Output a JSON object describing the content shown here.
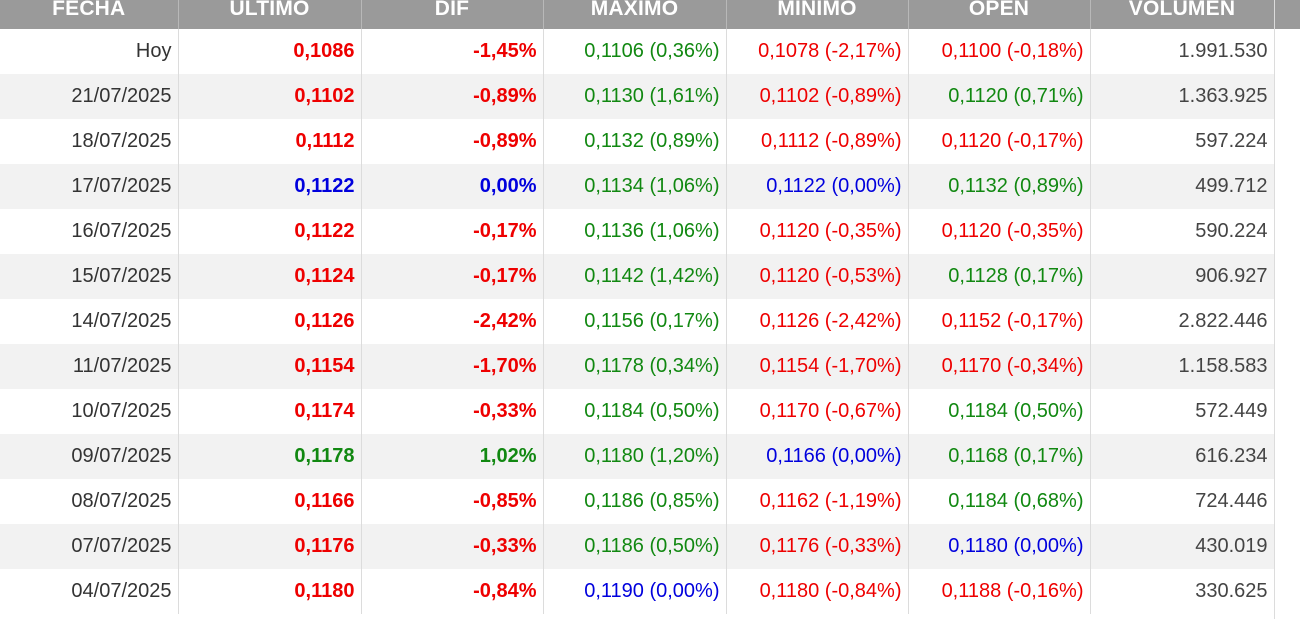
{
  "colors": {
    "red": "#ee0000",
    "green": "#118811",
    "blue": "#0000dd",
    "header_bg": "#9a9a9a"
  },
  "headers": [
    "FECHA",
    "ULTIMO",
    "DIF",
    "MAXIMO",
    "MINIMO",
    "OPEN",
    "VOLUMEN"
  ],
  "rows": [
    {
      "fecha": "Hoy",
      "ultimo": "0,1086",
      "ultimo_c": "red",
      "dif": "-1,45%",
      "dif_c": "red",
      "max": "0,1106 (0,36%)",
      "max_c": "green",
      "min": "0,1078 (-2,17%)",
      "min_c": "red",
      "open": "0,1100 (-0,18%)",
      "open_c": "red",
      "vol": "1.991.530"
    },
    {
      "fecha": "21/07/2025",
      "ultimo": "0,1102",
      "ultimo_c": "red",
      "dif": "-0,89%",
      "dif_c": "red",
      "max": "0,1130 (1,61%)",
      "max_c": "green",
      "min": "0,1102 (-0,89%)",
      "min_c": "red",
      "open": "0,1120 (0,71%)",
      "open_c": "green",
      "vol": "1.363.925"
    },
    {
      "fecha": "18/07/2025",
      "ultimo": "0,1112",
      "ultimo_c": "red",
      "dif": "-0,89%",
      "dif_c": "red",
      "max": "0,1132 (0,89%)",
      "max_c": "green",
      "min": "0,1112 (-0,89%)",
      "min_c": "red",
      "open": "0,1120 (-0,17%)",
      "open_c": "red",
      "vol": "597.224"
    },
    {
      "fecha": "17/07/2025",
      "ultimo": "0,1122",
      "ultimo_c": "blue",
      "dif": "0,00%",
      "dif_c": "blue",
      "max": "0,1134 (1,06%)",
      "max_c": "green",
      "min": "0,1122 (0,00%)",
      "min_c": "blue",
      "open": "0,1132 (0,89%)",
      "open_c": "green",
      "vol": "499.712"
    },
    {
      "fecha": "16/07/2025",
      "ultimo": "0,1122",
      "ultimo_c": "red",
      "dif": "-0,17%",
      "dif_c": "red",
      "max": "0,1136 (1,06%)",
      "max_c": "green",
      "min": "0,1120 (-0,35%)",
      "min_c": "red",
      "open": "0,1120 (-0,35%)",
      "open_c": "red",
      "vol": "590.224"
    },
    {
      "fecha": "15/07/2025",
      "ultimo": "0,1124",
      "ultimo_c": "red",
      "dif": "-0,17%",
      "dif_c": "red",
      "max": "0,1142 (1,42%)",
      "max_c": "green",
      "min": "0,1120 (-0,53%)",
      "min_c": "red",
      "open": "0,1128 (0,17%)",
      "open_c": "green",
      "vol": "906.927"
    },
    {
      "fecha": "14/07/2025",
      "ultimo": "0,1126",
      "ultimo_c": "red",
      "dif": "-2,42%",
      "dif_c": "red",
      "max": "0,1156 (0,17%)",
      "max_c": "green",
      "min": "0,1126 (-2,42%)",
      "min_c": "red",
      "open": "0,1152 (-0,17%)",
      "open_c": "red",
      "vol": "2.822.446"
    },
    {
      "fecha": "11/07/2025",
      "ultimo": "0,1154",
      "ultimo_c": "red",
      "dif": "-1,70%",
      "dif_c": "red",
      "max": "0,1178 (0,34%)",
      "max_c": "green",
      "min": "0,1154 (-1,70%)",
      "min_c": "red",
      "open": "0,1170 (-0,34%)",
      "open_c": "red",
      "vol": "1.158.583"
    },
    {
      "fecha": "10/07/2025",
      "ultimo": "0,1174",
      "ultimo_c": "red",
      "dif": "-0,33%",
      "dif_c": "red",
      "max": "0,1184 (0,50%)",
      "max_c": "green",
      "min": "0,1170 (-0,67%)",
      "min_c": "red",
      "open": "0,1184 (0,50%)",
      "open_c": "green",
      "vol": "572.449"
    },
    {
      "fecha": "09/07/2025",
      "ultimo": "0,1178",
      "ultimo_c": "green",
      "dif": "1,02%",
      "dif_c": "green",
      "max": "0,1180 (1,20%)",
      "max_c": "green",
      "min": "0,1166 (0,00%)",
      "min_c": "blue",
      "open": "0,1168 (0,17%)",
      "open_c": "green",
      "vol": "616.234"
    },
    {
      "fecha": "08/07/2025",
      "ultimo": "0,1166",
      "ultimo_c": "red",
      "dif": "-0,85%",
      "dif_c": "red",
      "max": "0,1186 (0,85%)",
      "max_c": "green",
      "min": "0,1162 (-1,19%)",
      "min_c": "red",
      "open": "0,1184 (0,68%)",
      "open_c": "green",
      "vol": "724.446"
    },
    {
      "fecha": "07/07/2025",
      "ultimo": "0,1176",
      "ultimo_c": "red",
      "dif": "-0,33%",
      "dif_c": "red",
      "max": "0,1186 (0,50%)",
      "max_c": "green",
      "min": "0,1176 (-0,33%)",
      "min_c": "red",
      "open": "0,1180 (0,00%)",
      "open_c": "blue",
      "vol": "430.019"
    },
    {
      "fecha": "04/07/2025",
      "ultimo": "0,1180",
      "ultimo_c": "red",
      "dif": "-0,84%",
      "dif_c": "red",
      "max": "0,1190 (0,00%)",
      "max_c": "blue",
      "min": "0,1180 (-0,84%)",
      "min_c": "red",
      "open": "0,1188 (-0,16%)",
      "open_c": "red",
      "vol": "330.625"
    }
  ]
}
